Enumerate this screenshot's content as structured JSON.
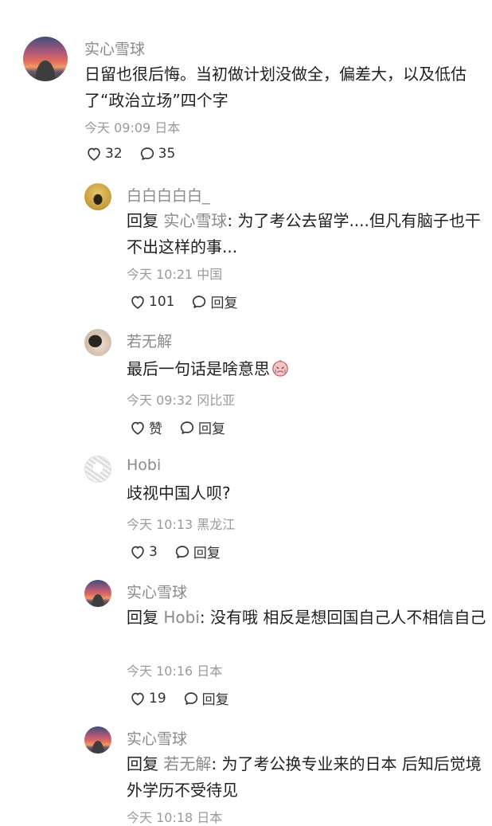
{
  "comments": [
    {
      "user": "实心雪球",
      "text": "日留也很后悔。当初做计划没做全，偏差大，以及低估了“政治立场”四个字",
      "meta": "今天 09:09 日本",
      "likes": "32",
      "replies": "35"
    },
    {
      "user": "白白白白白_",
      "reply_prefix": "回复",
      "reply_target": "实心雪球",
      "text": ": 为了考公去留学....但凡有脑子也干不出这样的事...",
      "meta": "今天 10:21 中国",
      "likes": "101",
      "reply_label": "回复"
    },
    {
      "user": "若无解",
      "text": "最后一句话是啥意思",
      "sticker": "crying-face-sticker",
      "meta": "今天 09:32 冈比亚",
      "likes": "赞",
      "reply_label": "回复"
    },
    {
      "user": "Hobi",
      "text": "歧视中国人呗?",
      "meta": "今天 10:13 黑龙江",
      "likes": "3",
      "reply_label": "回复"
    },
    {
      "user": "实心雪球",
      "reply_prefix": "回复",
      "reply_target": "Hobi",
      "text": ": 没有哦 相反是想回国自己人不相信自己",
      "meta": "今天 10:16 日本",
      "likes": "19",
      "reply_label": "回复"
    },
    {
      "user": "实心雪球",
      "reply_prefix": "回复",
      "reply_target": "若无解",
      "text": ": 为了考公换专业来的日本 后知后觉境外学历不受待见",
      "meta": "今天 10:18 日本"
    }
  ]
}
